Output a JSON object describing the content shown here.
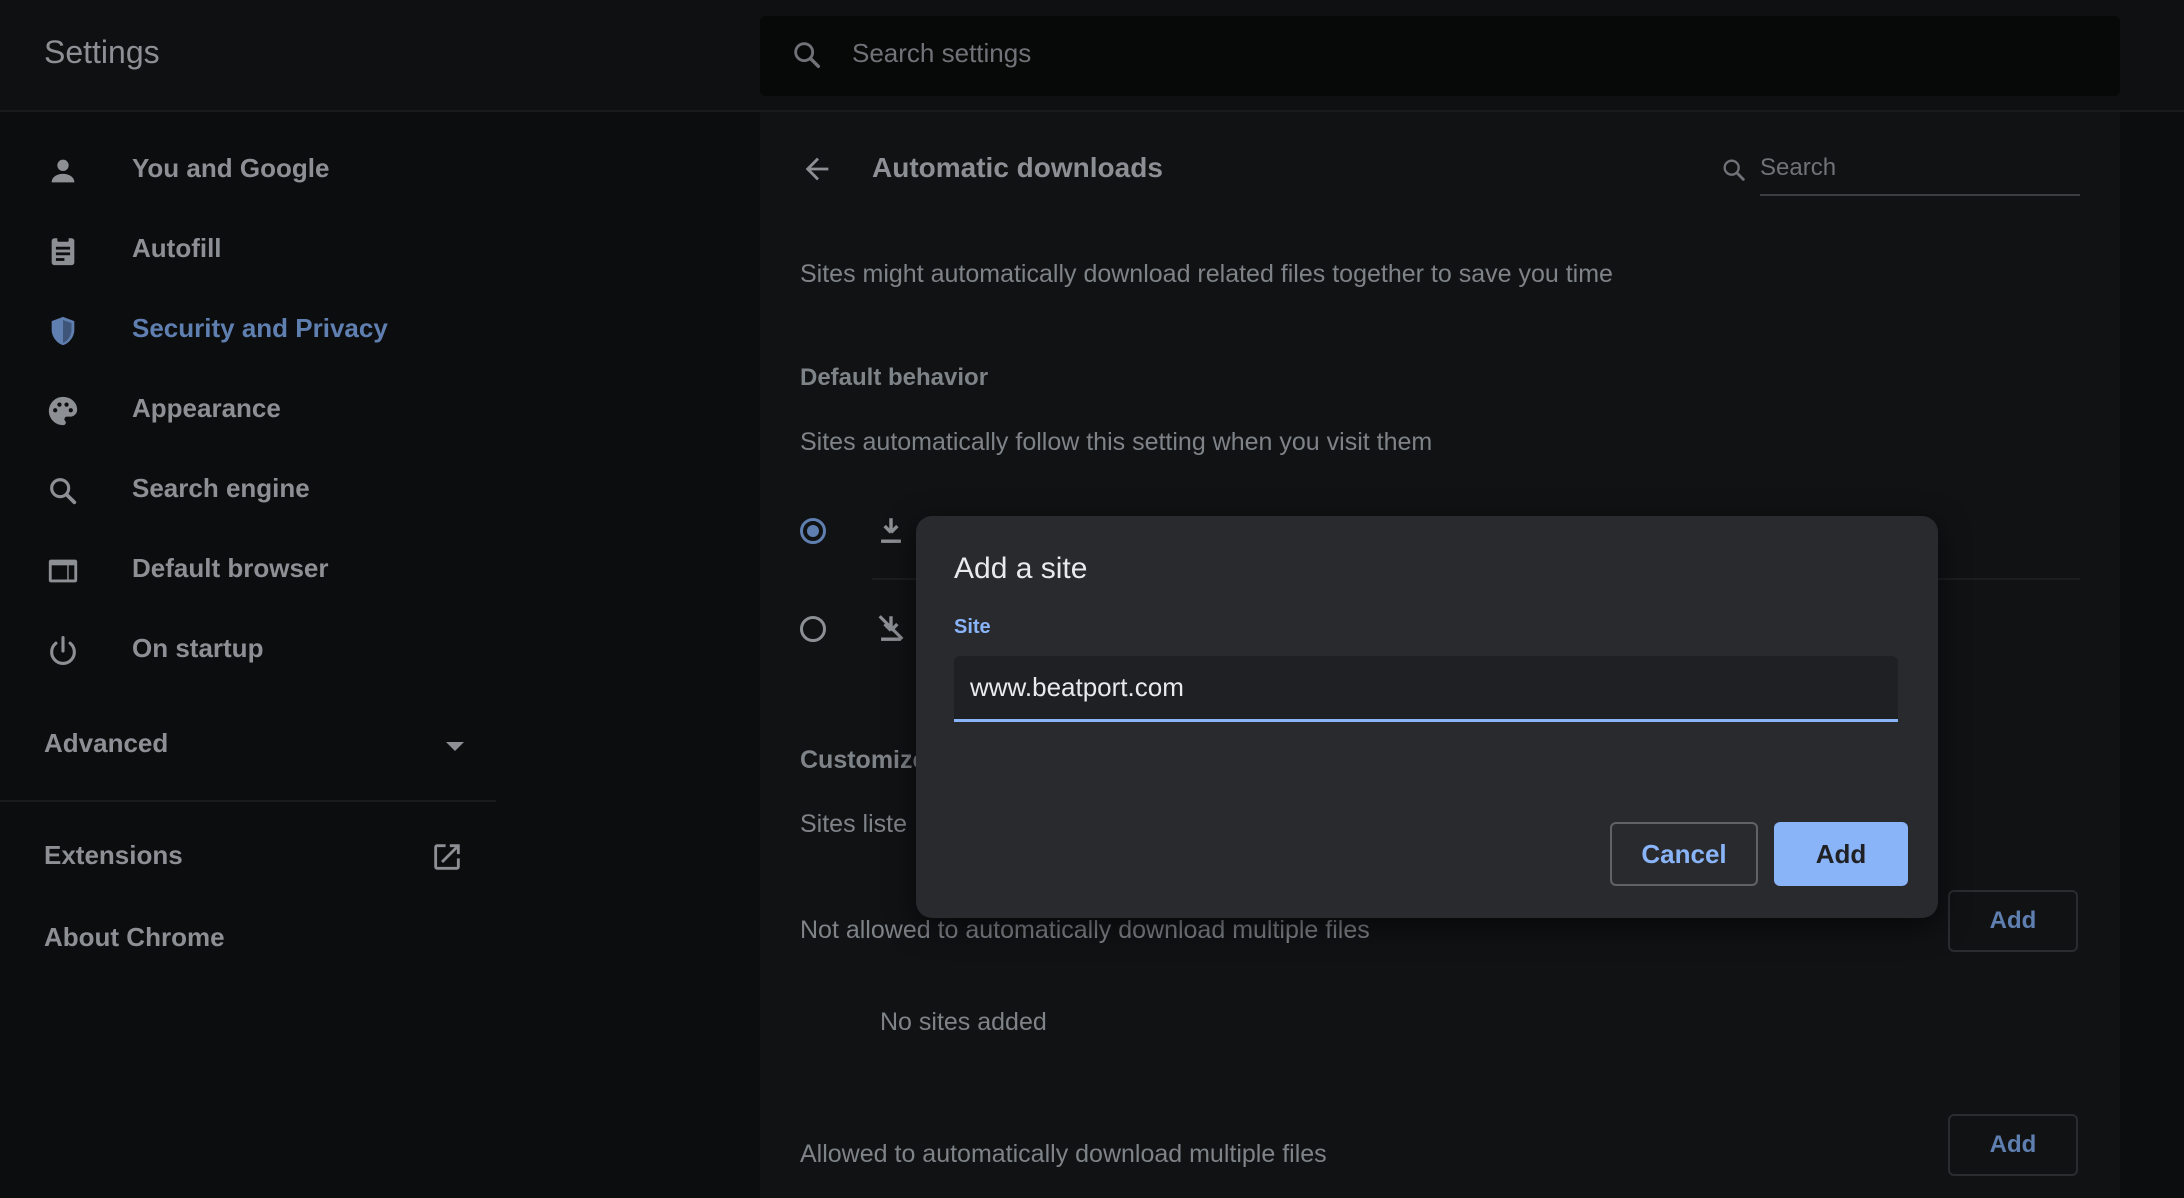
{
  "header": {
    "title": "Settings",
    "search_placeholder": "Search settings"
  },
  "sidebar": {
    "items": [
      {
        "label": "You and Google",
        "icon": "person-icon",
        "active": false
      },
      {
        "label": "Autofill",
        "icon": "clipboard-icon",
        "active": false
      },
      {
        "label": "Security and Privacy",
        "icon": "shield-icon",
        "active": true
      },
      {
        "label": "Appearance",
        "icon": "palette-icon",
        "active": false
      },
      {
        "label": "Search engine",
        "icon": "search-icon",
        "active": false
      },
      {
        "label": "Default browser",
        "icon": "browser-window-icon",
        "active": false
      },
      {
        "label": "On startup",
        "icon": "power-icon",
        "active": false
      }
    ],
    "advanced_label": "Advanced",
    "extensions_label": "Extensions",
    "about_label": "About Chrome"
  },
  "main": {
    "title": "Automatic downloads",
    "search_placeholder": "Search",
    "description": "Sites might automatically download related files together to save you time",
    "default_behavior": {
      "heading": "Default behavior",
      "subtext": "Sites automatically follow this setting when you visit them"
    },
    "customized": {
      "heading": "Customize",
      "subtext": "Sites liste"
    },
    "not_allowed": {
      "label": "Not allowed to automatically download multiple files",
      "add_label": "Add",
      "empty_text": "No sites added"
    },
    "allowed": {
      "label": "Allowed to automatically download multiple files",
      "add_label": "Add"
    }
  },
  "dialog": {
    "title": "Add a site",
    "field_label": "Site",
    "site_value": "www.beatport.com",
    "cancel_label": "Cancel",
    "add_label": "Add"
  },
  "colors": {
    "accent": "#8ab4f8",
    "dialog_bg": "#292a2d",
    "page_bg": "#0c0d0e"
  }
}
